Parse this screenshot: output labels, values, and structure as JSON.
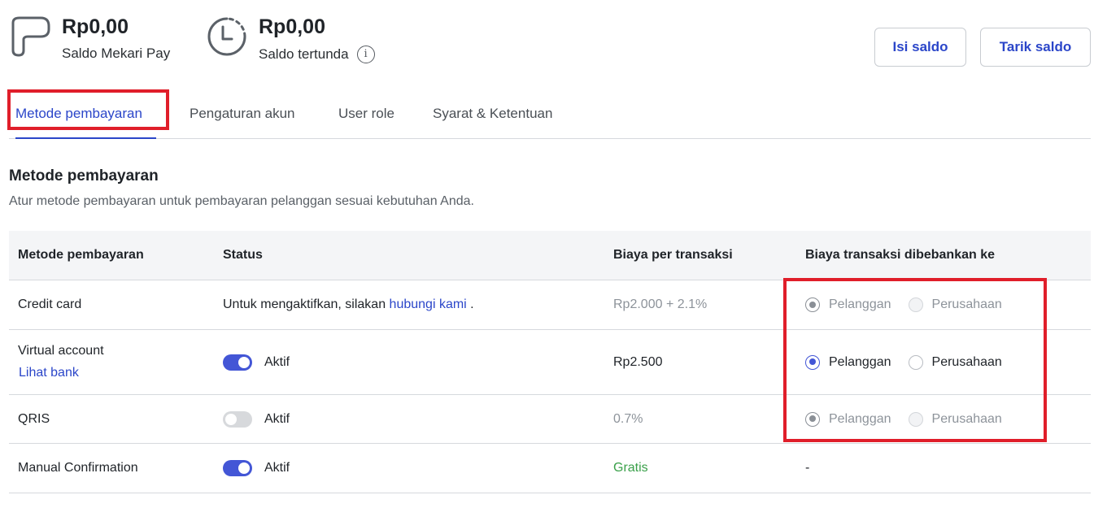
{
  "header": {
    "wallet": {
      "amount": "Rp0,00",
      "label": "Saldo Mekari Pay",
      "icon": "wallet-icon"
    },
    "pending": {
      "amount": "Rp0,00",
      "label": "Saldo tertunda",
      "icon": "clock-icon",
      "info_icon": "info-icon",
      "info_glyph": "i"
    },
    "topup_label": "Isi saldo",
    "withdraw_label": "Tarik saldo"
  },
  "tabs": [
    {
      "label": "Metode pembayaran",
      "active": true
    },
    {
      "label": "Pengaturan akun",
      "active": false
    },
    {
      "label": "User role",
      "active": false
    },
    {
      "label": "Syarat & Ketentuan",
      "active": false
    }
  ],
  "section": {
    "title": "Metode pembayaran",
    "description": "Atur metode pembayaran untuk pembayaran pelanggan sesuai kebutuhan Anda."
  },
  "table": {
    "columns": [
      "Metode pembayaran",
      "Status",
      "Biaya per transaksi",
      "Biaya transaksi dibebankan ke"
    ],
    "rows": [
      {
        "method": "Credit card",
        "status_text_prefix": "Untuk mengaktifkan, silakan ",
        "status_link": "hubungi kami",
        "status_text_suffix": " .",
        "fee": "Rp2.000 + 2.1%",
        "charge": {
          "option_a": "Pelanggan",
          "option_b": "Perusahaan",
          "selected": "Pelanggan",
          "disabled": true
        }
      },
      {
        "method": "Virtual account",
        "method_link": "Lihat bank",
        "status": "Aktif",
        "toggle_on": true,
        "fee": "Rp2.500",
        "charge": {
          "option_a": "Pelanggan",
          "option_b": "Perusahaan",
          "selected": "Pelanggan",
          "disabled": false
        }
      },
      {
        "method": "QRIS",
        "status": "Aktif",
        "toggle_on": false,
        "fee": "0.7%",
        "charge": {
          "option_a": "Pelanggan",
          "option_b": "Perusahaan",
          "selected": "Pelanggan",
          "disabled": true
        }
      },
      {
        "method": "Manual Confirmation",
        "status": "Aktif",
        "toggle_on": true,
        "fee": "Gratis",
        "charge_text": "-"
      }
    ]
  },
  "colors": {
    "accent": "#2b46c9",
    "toggle_on": "#4356d6",
    "highlight": "#e01e2a",
    "free_fee": "#3aa04a"
  }
}
